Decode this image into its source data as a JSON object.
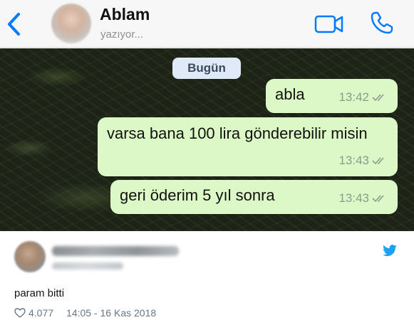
{
  "header": {
    "contact_name": "Ablam",
    "status": "yazıyor...",
    "icons": [
      "chevron-left-icon",
      "video-camera-icon",
      "phone-icon"
    ],
    "accent_color": "#007aff"
  },
  "chat": {
    "date_chip": "Bugün",
    "bubble_color": "#dcf8c6",
    "messages": [
      {
        "text": "abla",
        "time": "13:42",
        "status": "read-double-tick"
      },
      {
        "text": "varsa bana 100 lira gönderebilir misin",
        "time": "13:43",
        "status": "read-double-tick"
      },
      {
        "text": "geri öderim 5 yıl sonra",
        "time": "13:43",
        "status": "read-double-tick"
      }
    ]
  },
  "tweet": {
    "text": "param bitti",
    "likes": "4.077",
    "timestamp": "14:05 - 16 Kas 2018",
    "icons": [
      "twitter-bird-icon",
      "heart-icon"
    ],
    "brand_color": "#1da1f2"
  }
}
